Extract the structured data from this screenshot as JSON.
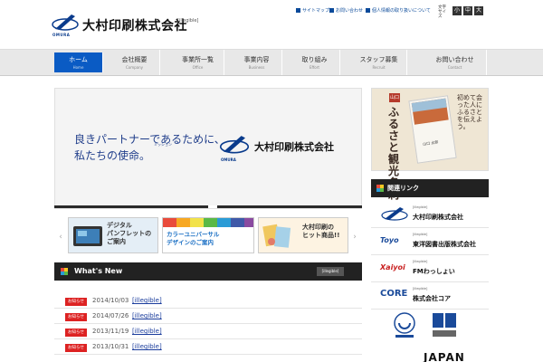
{
  "header": {
    "logo_sub": "OMURA",
    "company_name": "大村印刷株式会社",
    "tagline": "[illegible]",
    "util_links": [
      {
        "label": "サイトマップ"
      },
      {
        "label": "お問い合わせ"
      },
      {
        "label": "個人情報の取り扱いについて"
      }
    ],
    "font_size_label": "文字サイズ",
    "font_sizes": [
      "小",
      "中",
      "大"
    ]
  },
  "nav": [
    {
      "jp": "ホーム",
      "en": "Home",
      "active": true
    },
    {
      "jp": "会社概要",
      "en": "Company",
      "active": false
    },
    {
      "jp": "事業所一覧",
      "en": "Office",
      "active": false
    },
    {
      "jp": "事業内容",
      "en": "Business",
      "active": false
    },
    {
      "jp": "取り組み",
      "en": "Effort",
      "active": false
    },
    {
      "jp": "スタッフ募集",
      "en": "Recruit",
      "active": false
    },
    {
      "jp": "お問い合わせ",
      "en": "Contact",
      "active": false
    }
  ],
  "hero": {
    "line1": "良きパートナーであるために、",
    "line2": "私たちの使命。",
    "ruby": "ミッション",
    "logo_sub": "OMURA",
    "company_name": "大村印刷株式会社"
  },
  "banners": [
    {
      "text": "デジタル\nパンフレットの\nご案内"
    },
    {
      "text": "カラーユニバーサル\nデザインのご案内"
    },
    {
      "text": "大村印刷の\nヒット商品!!"
    }
  ],
  "news": {
    "title": "What's New",
    "list_button": "[illegible]",
    "items": [
      {
        "badge": "お知らせ",
        "date": "2014/10/03",
        "text": "[illegible]"
      },
      {
        "badge": "お知らせ",
        "date": "2014/07/26",
        "text": "[illegible]"
      },
      {
        "badge": "お知らせ",
        "date": "2013/11/19",
        "text": "[illegible]"
      },
      {
        "badge": "お知らせ",
        "date": "2013/10/31",
        "text": "[illegible]"
      }
    ]
  },
  "sidebar": {
    "ad": {
      "tag": "山口",
      "headline": "ふるさと観光名刺",
      "vertical": "初めて会った人にふるさとを伝えよう。",
      "card_name": "山口 太郎"
    },
    "related_title": "関連リンク",
    "links": [
      {
        "logo": "OMURA",
        "sub": "[illegible]",
        "name": "大村印刷株式会社"
      },
      {
        "logo": "Toyo",
        "sub": "[illegible]",
        "name": "東洋図書出版株式会社"
      },
      {
        "logo": "Xaiyoi",
        "sub": "[illegible]",
        "name": "FMわっしょい"
      },
      {
        "logo": "CORE",
        "sub": "[illegible]",
        "name": "株式会社コア"
      }
    ],
    "bottom_text": "JAPAN"
  },
  "colors": {
    "brand_blue": "#0a5bc4",
    "news_badge": "#d22222",
    "header_dark": "#222222"
  }
}
